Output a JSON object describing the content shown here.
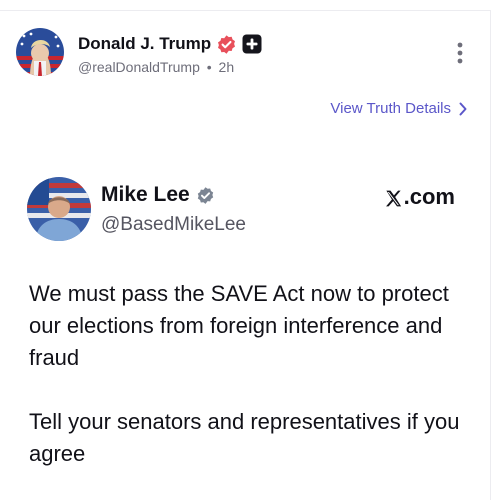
{
  "post": {
    "author_name": "Donald J. Trump",
    "handle": "@realDonaldTrump",
    "separator": "•",
    "time": "2h",
    "view_details": "View Truth Details"
  },
  "embed": {
    "author_name": "Mike Lee",
    "handle": "@BasedMikeLee",
    "source": ".com",
    "paragraphs": [
      "We must pass the SAVE Act now to protect our elections from foreign interference and fraud",
      "Tell your senators and representatives if you agree"
    ]
  },
  "colors": {
    "accent": "#5b57c9",
    "verified_badge": "#e8505b",
    "text": "#111118",
    "muted": "#6e6e7a"
  },
  "icons": [
    "verified-icon",
    "plus-icon",
    "more-vertical-icon",
    "chevron-right-icon",
    "x-logo-icon"
  ]
}
